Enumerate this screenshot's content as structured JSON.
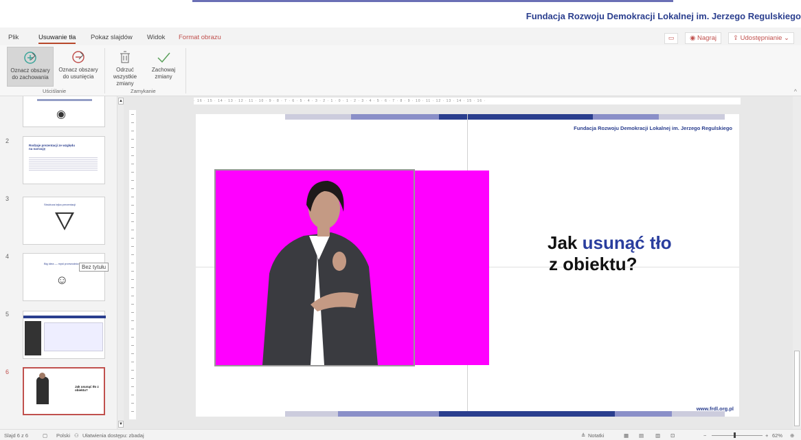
{
  "banner": {
    "org": "Fundacja Rozwoju Demokracji Lokalnej im. Jerzego Regulskiego"
  },
  "tabs": [
    {
      "label": "Plik"
    },
    {
      "label": "Usuwanie tła",
      "active": true
    },
    {
      "label": "Pokaz slajdów"
    },
    {
      "label": "Widok"
    },
    {
      "label": "Format obrazu",
      "contextual": true
    }
  ],
  "tab_actions": {
    "record": "Nagraj",
    "share": "Udostępnianie"
  },
  "ribbon": {
    "mark_keep": "Oznacz obszary do zachowania",
    "mark_remove": "Oznacz obszary do usunięcia",
    "discard": "Odrzuć wszystkie zmiany",
    "keep_changes": "Zachowaj zmiany",
    "group_refine": "Uściślanie",
    "group_close": "Zamykanie"
  },
  "thumbnails": [
    {
      "num": "",
      "title": ""
    },
    {
      "num": "2",
      "title": "Rodzaje prezentacji ze względu na narrację"
    },
    {
      "num": "3",
      "title": "Struktura lejka prezentacji"
    },
    {
      "num": "4",
      "title": "Bez tytułu"
    },
    {
      "num": "5",
      "title": ""
    },
    {
      "num": "6",
      "title": "Jak usunąć tło z obiektu?"
    }
  ],
  "tooltip": "Bez tytułu",
  "slide": {
    "org": "Fundacja Rozwoju Demokracji Lokalnej im. Jerzego Regulskiego",
    "title_prefix": "Jak ",
    "title_highlight": "usunąć tło",
    "title_line2": "z obiektu?",
    "url": "www.frdl.org.pl"
  },
  "ruler_text": "· 16 · 15 · 14 · 13 · 12 · 11 · 10 · 9 · 8 · 7 · 6 · 5 · 4 · 3 · 2 · 1 · 0 · 1 · 2 · 3 · 4 · 5 · 6 · 7 · 8 · 9 · 10 · 11 · 12 · 13 · 14 · 15 · 16 ·",
  "status": {
    "slide_count": "Slajd 6 z 6",
    "language": "Polski",
    "accessibility": "Ułatwienia dostępu: zbadaj",
    "notes": "Notatki",
    "zoom": "62%"
  },
  "colors": {
    "accent": "#c0504d",
    "brand_blue": "#2a3e8e",
    "magenta": "#ff00ff"
  }
}
